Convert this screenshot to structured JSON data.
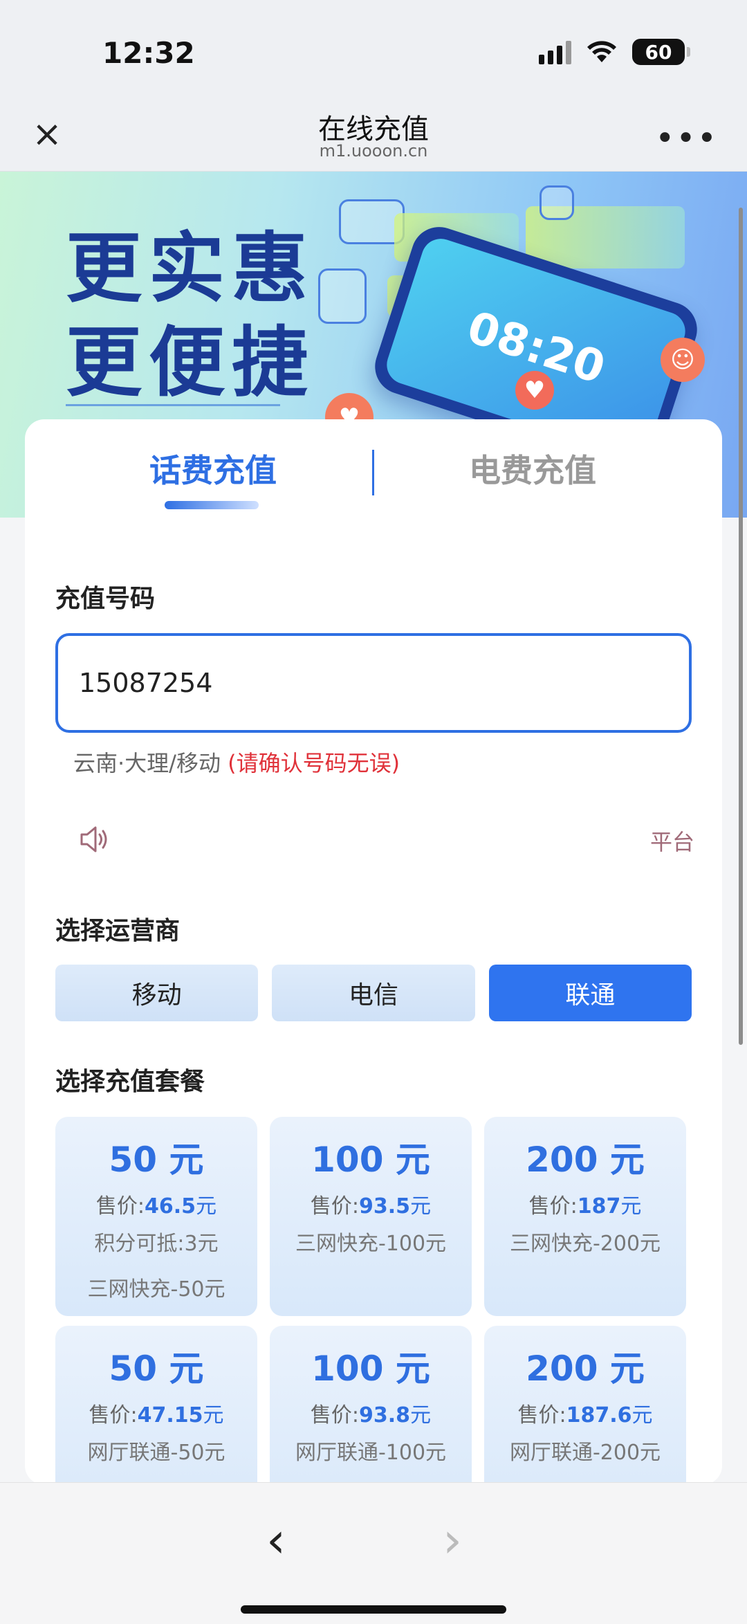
{
  "status_bar": {
    "time": "12:32",
    "battery": "60"
  },
  "nav": {
    "title": "在线充值",
    "subtitle": "m1.uooon.cn"
  },
  "banner": {
    "line1": "更实惠",
    "line2": "更便捷",
    "phone_time": "08:20"
  },
  "tabs": [
    {
      "label": "话费充值",
      "active": true
    },
    {
      "label": "电费充值",
      "active": false
    }
  ],
  "recharge": {
    "number_label": "充值号码",
    "number_value": "15087254",
    "carrier_info": "云南·大理/移动",
    "carrier_warning": "(请确认号码无误)",
    "notice_text": "平台"
  },
  "operators": {
    "label": "选择运营商",
    "items": [
      {
        "label": "移动",
        "active": false
      },
      {
        "label": "电信",
        "active": false
      },
      {
        "label": "联通",
        "active": true
      }
    ]
  },
  "packages": {
    "label": "选择充值套餐",
    "price_prefix": "售价:",
    "yuan": "元",
    "items": [
      {
        "amount": "50 元",
        "price": "46.5",
        "desc1": "积分可抵:3元",
        "desc2": "三网快充-50元"
      },
      {
        "amount": "100 元",
        "price": "93.5",
        "desc1": "三网快充-100元",
        "desc2": ""
      },
      {
        "amount": "200 元",
        "price": "187",
        "desc1": "三网快充-200元",
        "desc2": ""
      },
      {
        "amount": "50 元",
        "price": "47.15",
        "desc1": "网厅联通-50元",
        "desc2": ""
      },
      {
        "amount": "100 元",
        "price": "93.8",
        "desc1": "网厅联通-100元",
        "desc2": ""
      },
      {
        "amount": "200 元",
        "price": "187.6",
        "desc1": "网厅联通-200元",
        "desc2": ""
      }
    ]
  },
  "colors": {
    "accent": "#2f74ef",
    "warning": "#e0323a"
  },
  "icons": {
    "close": "close-icon",
    "more": "more-icon",
    "speaker": "speaker-icon",
    "back": "back-arrow-icon",
    "forward": "forward-arrow-icon"
  }
}
